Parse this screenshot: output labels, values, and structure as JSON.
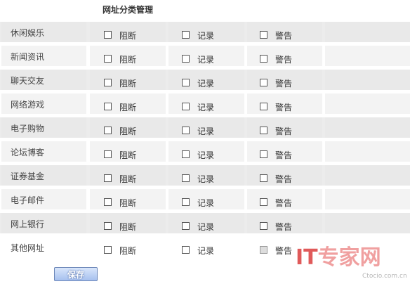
{
  "page": {
    "title": "网址分类管理"
  },
  "options": {
    "block": "阻断",
    "record": "记录",
    "alert": "警告"
  },
  "categories": [
    {
      "label": "休闲娱乐",
      "block": false,
      "record": false,
      "alert": false
    },
    {
      "label": "新闻资讯",
      "block": false,
      "record": false,
      "alert": false
    },
    {
      "label": "聊天交友",
      "block": false,
      "record": false,
      "alert": false
    },
    {
      "label": "网络游戏",
      "block": false,
      "record": false,
      "alert": false
    },
    {
      "label": "电子购物",
      "block": false,
      "record": false,
      "alert": false
    },
    {
      "label": "论坛博客",
      "block": false,
      "record": false,
      "alert": false
    },
    {
      "label": "证券基金",
      "block": false,
      "record": false,
      "alert": false
    },
    {
      "label": "电子邮件",
      "block": false,
      "record": false,
      "alert": false
    },
    {
      "label": "网上银行",
      "block": false,
      "record": false,
      "alert": false
    },
    {
      "label": "其他网址",
      "block": false,
      "record": false,
      "alert": false,
      "alert_disabled": true
    }
  ],
  "actions": {
    "save_label": "保存"
  },
  "watermark": {
    "brand_it": "IT",
    "brand_rest": "专家网",
    "site": "Ctocio.com.cn"
  }
}
